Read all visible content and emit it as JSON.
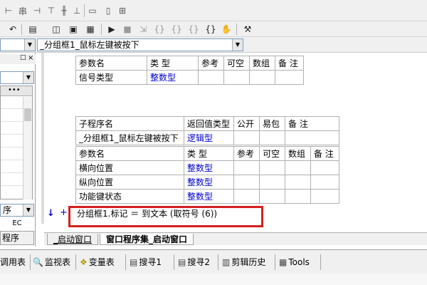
{
  "toolbar_top": {
    "icons": [
      "align-left-icon",
      "align-center-icon",
      "align-right-icon",
      "align-top-icon",
      "align-middle-icon",
      "align-bottom-icon",
      "same-width-icon",
      "same-height-icon",
      "same-size-icon"
    ]
  },
  "toolbar_second": {
    "icons": [
      "undo-icon",
      "find-icon",
      "view-layout-a-icon",
      "view-layout-b-icon",
      "view-layout-c-icon",
      "run-icon",
      "stop-icon",
      "step-icons",
      "breakpoint-icon",
      "compile-icon"
    ]
  },
  "subroutine_selector": {
    "value": "_分组框1_鼠标左键被按下"
  },
  "left_panel": {
    "ec_label": "EC",
    "combo_value": "序",
    "tab_label": "程序"
  },
  "params_table1": {
    "headers": [
      "参数名",
      "类 型",
      "参考",
      "可空",
      "数组",
      "备 注"
    ],
    "rows": [
      [
        "信号类型",
        "整数型",
        "",
        "",
        "",
        ""
      ]
    ]
  },
  "sub_table": {
    "headers": [
      "子程序名",
      "返回值类型",
      "公开",
      "易包",
      "备 注"
    ],
    "row": [
      "_分组框1_鼠标左键被按下",
      "逻辑型",
      "",
      "",
      ""
    ],
    "param_headers": [
      "参数名",
      "类 型",
      "参考",
      "可空",
      "数组",
      "备 注"
    ],
    "params": [
      [
        "横向位置",
        "整数型"
      ],
      [
        "纵向位置",
        "整数型"
      ],
      [
        "功能键状态",
        "整数型"
      ]
    ]
  },
  "code": {
    "line": "分组框1.标记 ＝ 到文本 (取符号 (6))",
    "arrow": "↓",
    "plus": "+"
  },
  "editor_tabs": [
    "_启动窗口",
    "窗口程序集_启动窗口"
  ],
  "bottom_tabs": [
    {
      "icon": "table-icon",
      "label": "调用表"
    },
    {
      "icon": "search-icon",
      "label": "监视表"
    },
    {
      "icon": "variables-icon",
      "label": "变量表"
    },
    {
      "icon": "find1-icon",
      "label": "搜寻1"
    },
    {
      "icon": "find2-icon",
      "label": "搜寻2"
    },
    {
      "icon": "clipboard-icon",
      "label": "剪辑历史"
    },
    {
      "icon": "tools-icon",
      "label": "Tools"
    }
  ],
  "colors": {
    "type_link": "#0000cc",
    "highlight_box": "#d42020"
  }
}
